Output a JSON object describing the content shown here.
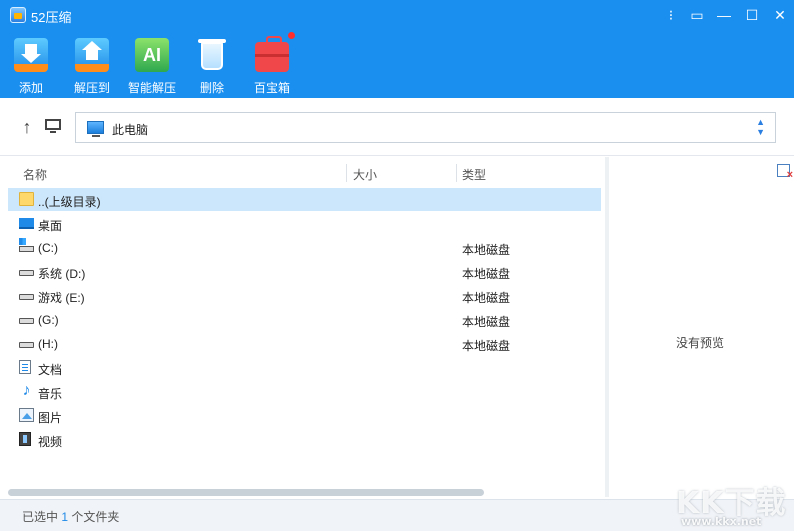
{
  "app": {
    "title": "52压缩"
  },
  "window_controls": [
    "⁝",
    "▭",
    "—",
    "☐",
    "✕"
  ],
  "toolbar": {
    "items": [
      {
        "label": "添加",
        "icon": "add-archive-icon"
      },
      {
        "label": "解压到",
        "icon": "extract-icon"
      },
      {
        "label": "智能解压",
        "icon": "smart-extract-icon",
        "icon_text": "AI"
      },
      {
        "label": "删除",
        "icon": "trash-icon"
      },
      {
        "label": "百宝箱",
        "icon": "toolbox-icon"
      }
    ]
  },
  "nav": {
    "up_glyph": "↑",
    "address": "此电脑",
    "dropdown_up": "▲",
    "dropdown_down": "▼"
  },
  "columns": {
    "name": "名称",
    "size": "大小",
    "type": "类型"
  },
  "rows": [
    {
      "name": "..(上级目录)",
      "type": "",
      "icon": "folder-icon",
      "selected": true
    },
    {
      "name": "桌面",
      "type": "",
      "icon": "desktop-icon"
    },
    {
      "name": " (C:)",
      "type": "本地磁盘",
      "icon": "system-drive-icon"
    },
    {
      "name": "系统 (D:)",
      "type": "本地磁盘",
      "icon": "drive-icon"
    },
    {
      "name": "游戏 (E:)",
      "type": "本地磁盘",
      "icon": "drive-icon"
    },
    {
      "name": " (G:)",
      "type": "本地磁盘",
      "icon": "drive-icon"
    },
    {
      "name": " (H:)",
      "type": "本地磁盘",
      "icon": "drive-icon"
    },
    {
      "name": "文档",
      "type": "",
      "icon": "documents-icon"
    },
    {
      "name": "音乐",
      "type": "",
      "icon": "music-icon",
      "glyph": "♪"
    },
    {
      "name": "图片",
      "type": "",
      "icon": "pictures-icon"
    },
    {
      "name": "视频",
      "type": "",
      "icon": "video-icon"
    }
  ],
  "preview": {
    "empty_text": "没有预览"
  },
  "status": {
    "prefix": "已选中 ",
    "count": "1",
    "suffix": " 个文件夹"
  },
  "watermark": {
    "main": "KK下载",
    "sub": "www.kkx.net"
  },
  "colors": {
    "accent": "#1a8ff0",
    "selection": "#cce6fb"
  }
}
